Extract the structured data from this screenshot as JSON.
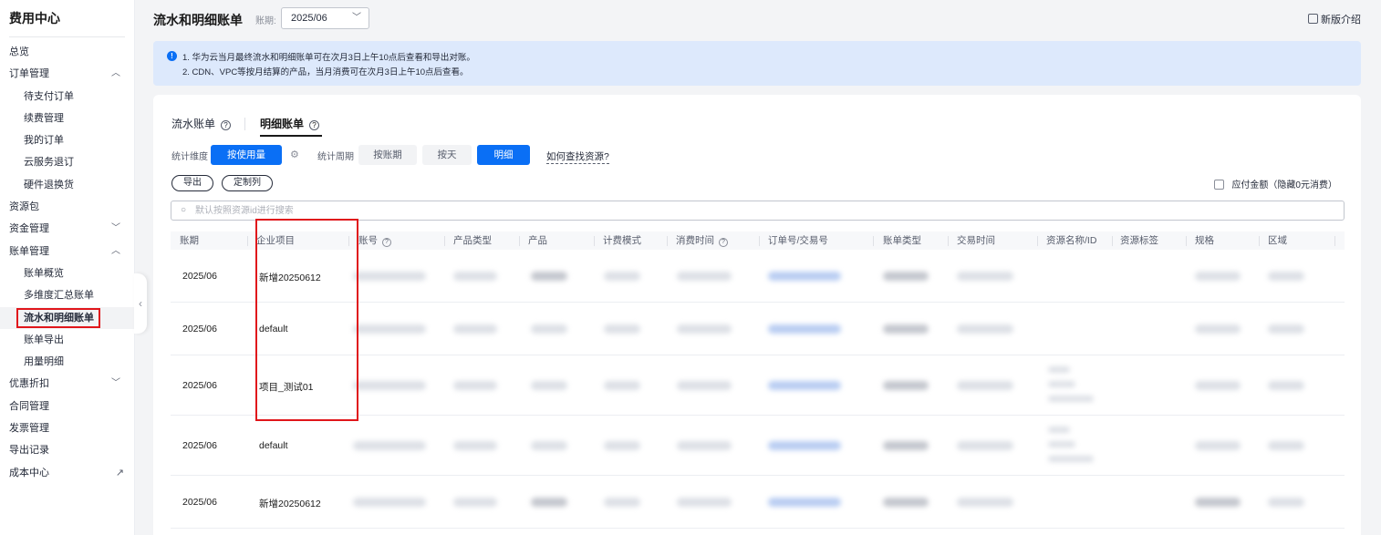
{
  "sidebar": {
    "title": "费用中心",
    "items": [
      {
        "label": "总览",
        "level": 0,
        "chevron": ""
      },
      {
        "label": "订单管理",
        "level": 0,
        "chevron": "up"
      },
      {
        "label": "待支付订单",
        "level": 1
      },
      {
        "label": "续费管理",
        "level": 1
      },
      {
        "label": "我的订单",
        "level": 1
      },
      {
        "label": "云服务退订",
        "level": 1
      },
      {
        "label": "硬件退换货",
        "level": 1
      },
      {
        "label": "资源包",
        "level": 0
      },
      {
        "label": "资金管理",
        "level": 0,
        "chevron": "down"
      },
      {
        "label": "账单管理",
        "level": 0,
        "chevron": "up"
      },
      {
        "label": "账单概览",
        "level": 1
      },
      {
        "label": "多维度汇总账单",
        "level": 1
      },
      {
        "label": "流水和明细账单",
        "level": 1,
        "active": true
      },
      {
        "label": "账单导出",
        "level": 1
      },
      {
        "label": "用量明细",
        "level": 1
      },
      {
        "label": "优惠折扣",
        "level": 0,
        "chevron": "down"
      },
      {
        "label": "合同管理",
        "level": 0
      },
      {
        "label": "发票管理",
        "level": 0
      },
      {
        "label": "导出记录",
        "level": 0
      },
      {
        "label": "成本中心",
        "level": 0,
        "external": true
      }
    ]
  },
  "header": {
    "title": "流水和明细账单",
    "period_label": "账期:",
    "period_value": "2025/06",
    "new_intro": "新版介绍"
  },
  "notice": {
    "line1": "1. 华为云当月最终流水和明细账单可在次月3日上午10点后查看和导出对账。",
    "line2": "2. CDN、VPC等按月结算的产品，当月消费可在次月3日上午10点后查看。"
  },
  "tabs": {
    "flow": "流水账单",
    "detail": "明细账单"
  },
  "filters": {
    "dim_label": "统计维度",
    "dim_value": "按使用量",
    "cycle_label": "统计周期",
    "cycle_options": [
      "按账期",
      "按天",
      "明细"
    ],
    "how_link": "如何查找资源?"
  },
  "actions": {
    "export": "导出",
    "customize": "定制列",
    "hide_zero": "应付金额（隐藏0元消费）"
  },
  "search": {
    "placeholder": "默认按照资源id进行搜索"
  },
  "table": {
    "columns": [
      "账期",
      "企业项目",
      "账号",
      "产品类型",
      "产品",
      "计费模式",
      "消费时间",
      "订单号/交易号",
      "账单类型",
      "交易时间",
      "资源名称/ID",
      "资源标签",
      "规格",
      "区域"
    ],
    "rows": [
      {
        "period": "2025/06",
        "project": "新增20250612"
      },
      {
        "period": "2025/06",
        "project": "default"
      },
      {
        "period": "2025/06",
        "project": "项目_测试01"
      },
      {
        "period": "2025/06",
        "project": "default"
      },
      {
        "period": "2025/06",
        "project": "新增20250612"
      }
    ]
  },
  "colors": {
    "accent": "#0a6ff5",
    "highlight": "#e0161b",
    "notice_bg": "#dde9fc"
  }
}
